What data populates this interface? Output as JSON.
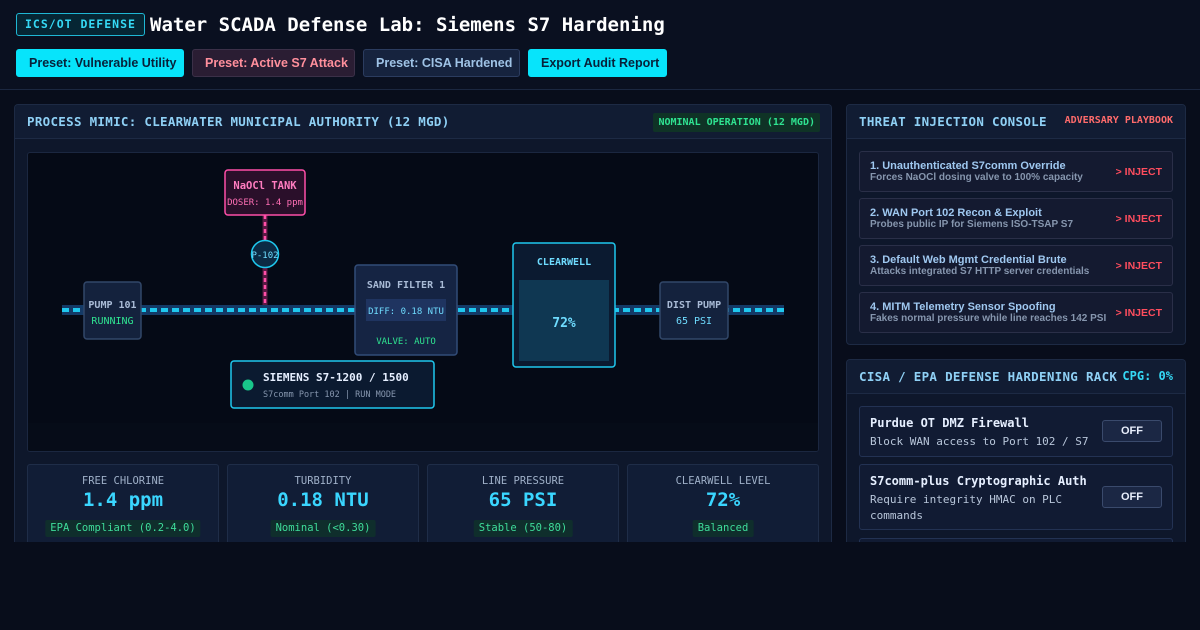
{
  "header": {
    "badge": "ICS/OT DEFENSE",
    "title": "Water SCADA Defense Lab: Siemens S7 Hardening",
    "buttons": {
      "vulnerable": "Preset: Vulnerable Utility",
      "attack": "Preset: Active S7 Attack",
      "hardened": "Preset: CISA Hardened",
      "export": "Export Audit Report"
    }
  },
  "mimic_panel": {
    "title": "PROCESS MIMIC: CLEARWATER MUNICIPAL AUTHORITY (12 MGD)",
    "status": "NOMINAL OPERATION (12 MGD)",
    "nodes": {
      "tank_title": "NaOCl TANK",
      "tank_sub": "DOSER: 1.4 ppm",
      "pump_label": "P-102",
      "pump101_title": "PUMP 101",
      "pump101_status": "RUNNING",
      "filter_title": "SAND FILTER 1",
      "filter_diff": "DIFF: 0.18 NTU",
      "filter_valve": "VALVE: AUTO",
      "clearwell_title": "CLEARWELL",
      "clearwell_level": "72%",
      "clearwell_fill": 0.72,
      "dist_title": "DIST PUMP",
      "dist_value": "65 PSI",
      "plc_title": "SIEMENS S7-1200 / 1500",
      "plc_sub": "S7comm Port 102 | RUN MODE"
    },
    "colors": {
      "pipe": "#1fc8ee",
      "dosing": "#ff4fa8",
      "ok": "#19c68a"
    }
  },
  "metrics": [
    {
      "label": "FREE CHLORINE",
      "value": "1.4 ppm",
      "tag": "EPA Compliant (0.2-4.0)"
    },
    {
      "label": "TURBIDITY",
      "value": "0.18 NTU",
      "tag": "Nominal (<0.30)"
    },
    {
      "label": "LINE PRESSURE",
      "value": "65 PSI",
      "tag": "Stable (50-80)"
    },
    {
      "label": "CLEARWELL LEVEL",
      "value": "72%",
      "tag": "Balanced"
    }
  ],
  "threat_panel": {
    "title": "THREAT INJECTION CONSOLE",
    "label": "ADVERSARY PLAYBOOK",
    "inject_label": "> INJECT",
    "items": [
      {
        "title": "1. Unauthenticated S7comm Override",
        "desc": "Forces NaOCl dosing valve to 100% capacity"
      },
      {
        "title": "2. WAN Port 102 Recon & Exploit",
        "desc": "Probes public IP for Siemens ISO-TSAP S7"
      },
      {
        "title": "3. Default Web Mgmt Credential Brute",
        "desc": "Attacks integrated S7 HTTP server credentials"
      },
      {
        "title": "4. MITM Telemetry Sensor Spoofing",
        "desc": "Fakes normal pressure while line reaches 142 PSI"
      }
    ]
  },
  "defense_panel": {
    "title": "CISA / EPA DEFENSE HARDENING RACK",
    "score": "CPG: 0%",
    "items": [
      {
        "title": "Purdue OT DMZ Firewall",
        "desc": "Block WAN access to Port 102 / S7",
        "state": "OFF"
      },
      {
        "title": "S7comm-plus Cryptographic Auth",
        "desc": "Require integrity HMAC on PLC commands",
        "state": "OFF"
      }
    ]
  }
}
